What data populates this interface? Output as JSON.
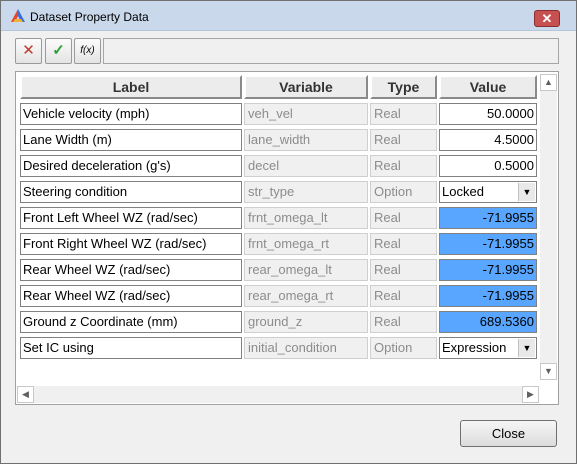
{
  "window": {
    "title": "Dataset Property Data",
    "close_glyph": "✕"
  },
  "toolbar": {
    "cancel_glyph": "✕",
    "apply_glyph": "✓",
    "fx_glyph": "f(x)",
    "expression_value": ""
  },
  "table": {
    "headers": {
      "label": "Label",
      "variable": "Variable",
      "type": "Type",
      "value": "Value"
    },
    "rows": [
      {
        "label": "Vehicle velocity (mph)",
        "variable": "veh_vel",
        "type": "Real",
        "value": "50.0000"
      },
      {
        "label": "Lane Width (m)",
        "variable": "lane_width",
        "type": "Real",
        "value": "4.5000"
      },
      {
        "label": "Desired deceleration (g's)",
        "variable": "decel",
        "type": "Real",
        "value": "0.5000"
      },
      {
        "label": "Steering condition",
        "variable": "str_type",
        "type": "Option",
        "value": "Locked"
      },
      {
        "label": "Front Left Wheel WZ (rad/sec)",
        "variable": "frnt_omega_lt",
        "type": "Real",
        "value": "-71.9955"
      },
      {
        "label": "Front Right Wheel WZ (rad/sec)",
        "variable": "frnt_omega_rt",
        "type": "Real",
        "value": "-71.9955"
      },
      {
        "label": "Rear Wheel WZ (rad/sec)",
        "variable": "rear_omega_lt",
        "type": "Real",
        "value": "-71.9955"
      },
      {
        "label": "Rear Wheel WZ (rad/sec)",
        "variable": "rear_omega_rt",
        "type": "Real",
        "value": "-71.9955"
      },
      {
        "label": "Ground z Coordinate (mm)",
        "variable": "ground_z",
        "type": "Real",
        "value": "689.5360"
      },
      {
        "label": "Set IC using",
        "variable": "initial_condition",
        "type": "Option",
        "value": "Expression"
      }
    ]
  },
  "scroll": {
    "up": "▲",
    "down": "▼",
    "left": "◀",
    "right": "▶"
  },
  "dropdown_glyph": "▼",
  "footer": {
    "close_label": "Close"
  },
  "colors": {
    "selected_value": "#58a6ff",
    "titlebar": "#c9d8eb"
  }
}
